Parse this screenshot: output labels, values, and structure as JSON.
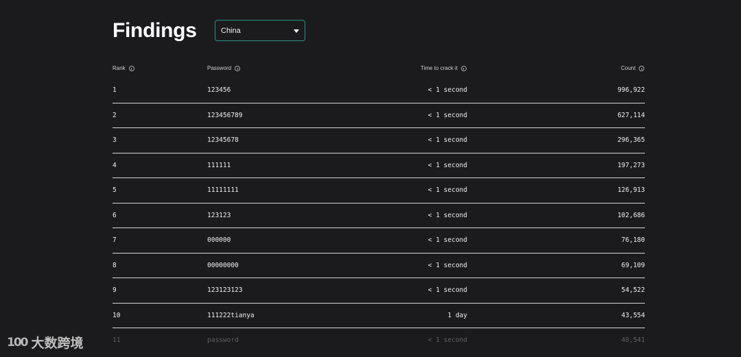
{
  "header": {
    "title": "Findings",
    "country_select": {
      "value": "China"
    }
  },
  "table": {
    "columns": {
      "rank": "Rank",
      "password": "Password",
      "time": "Time to crack it",
      "count": "Count"
    },
    "rows": [
      {
        "rank": "1",
        "password": "123456",
        "time": "< 1 second",
        "count": "996,922"
      },
      {
        "rank": "2",
        "password": "123456789",
        "time": "< 1 second",
        "count": "627,114"
      },
      {
        "rank": "3",
        "password": "12345678",
        "time": "< 1 second",
        "count": "296,365"
      },
      {
        "rank": "4",
        "password": "111111",
        "time": "< 1 second",
        "count": "197,273"
      },
      {
        "rank": "5",
        "password": "11111111",
        "time": "< 1 second",
        "count": "126,913"
      },
      {
        "rank": "6",
        "password": "123123",
        "time": "< 1 second",
        "count": "102,686"
      },
      {
        "rank": "7",
        "password": "000000",
        "time": "< 1 second",
        "count": "76,180"
      },
      {
        "rank": "8",
        "password": "00000000",
        "time": "< 1 second",
        "count": "69,109"
      },
      {
        "rank": "9",
        "password": "123123123",
        "time": "< 1 second",
        "count": "54,522"
      },
      {
        "rank": "10",
        "password": "111222tianya",
        "time": "1 day",
        "count": "43,554"
      },
      {
        "rank": "11",
        "password": "password",
        "time": "< 1 second",
        "count": "40,541"
      }
    ]
  },
  "watermark": {
    "logo": "100",
    "text": "大数跨境"
  }
}
